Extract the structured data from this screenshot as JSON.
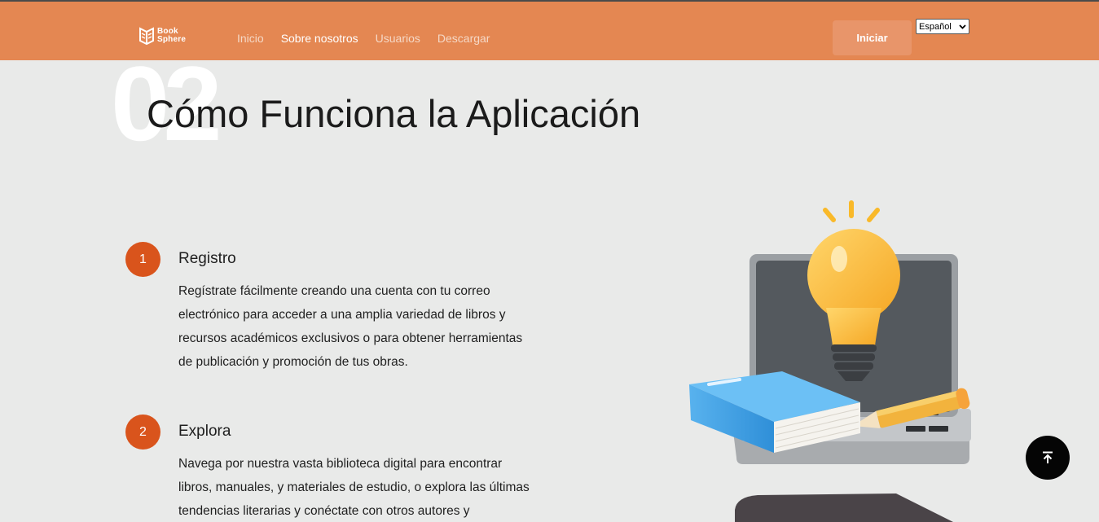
{
  "header": {
    "logo": {
      "line1": "Book",
      "line2": "Sphere"
    },
    "nav": [
      {
        "label": "Inicio",
        "active": false
      },
      {
        "label": "Sobre nosotros",
        "active": true
      },
      {
        "label": "Usuarios",
        "active": false
      },
      {
        "label": "Descargar",
        "active": false
      }
    ],
    "login_label": "Iniciar",
    "language": {
      "selected": "Español"
    }
  },
  "section": {
    "number": "02",
    "title": "Cómo Funciona la Aplicación"
  },
  "steps": [
    {
      "number": "1",
      "title": "Registro",
      "description": "Regístrate fácilmente creando una cuenta con tu correo electrónico para acceder a una amplia variedad de libros y recursos académicos exclusivos o para obtener herramientas de publicación y promoción de tus obras."
    },
    {
      "number": "2",
      "title": "Explora",
      "description": "Navega por nuestra vasta biblioteca digital para encontrar libros, manuales, y materiales de estudio, o explora las últimas tendencias literarias y conéctate con otros autores y"
    }
  ],
  "icons": {
    "logo": "book-sphere-logo-icon",
    "scroll_top": "arrow-up-to-line-icon",
    "dropdown": "chevron-down-icon"
  },
  "colors": {
    "header_bg": "#e48752",
    "accent": "#d9541c",
    "page_bg": "#e9eae9",
    "scroll_button": "#050505"
  }
}
